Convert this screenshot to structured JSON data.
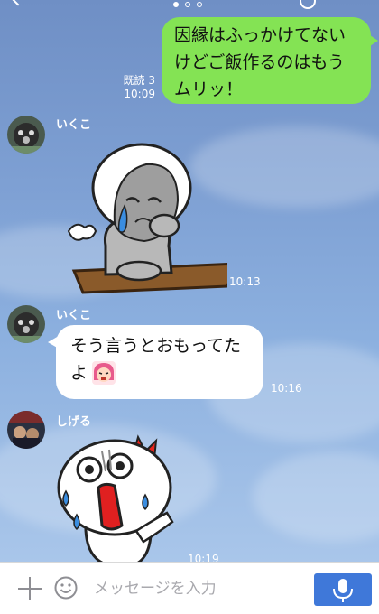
{
  "messages": [
    {
      "direction": "out",
      "lines": [
        "因縁はふっかけてない",
        "けどご飯作るのはもう",
        "ムリッ！"
      ],
      "read": "既読 3",
      "time": "10:09"
    },
    {
      "direction": "in",
      "sender": "いくこ",
      "type": "sticker",
      "sticker": "crying-moon-sticker",
      "time": "10:13"
    },
    {
      "direction": "in",
      "sender": "いくこ",
      "lines": [
        "そう言うとおもってた",
        "よ"
      ],
      "emoji": "crying-girl-emoji",
      "time": "10:16"
    },
    {
      "direction": "in",
      "sender": "しげる",
      "type": "sticker",
      "sticker": "shocked-moon-sticker",
      "time": "10:19"
    }
  ],
  "input": {
    "placeholder": "メッセージを入力",
    "value": ""
  },
  "colors": {
    "outgoing_bubble": "#84e354",
    "incoming_bubble": "#ffffff",
    "mic_button": "#3f78d9"
  },
  "icons": [
    "back-chevron-icon",
    "plus-icon",
    "smiley-icon",
    "mic-icon"
  ]
}
